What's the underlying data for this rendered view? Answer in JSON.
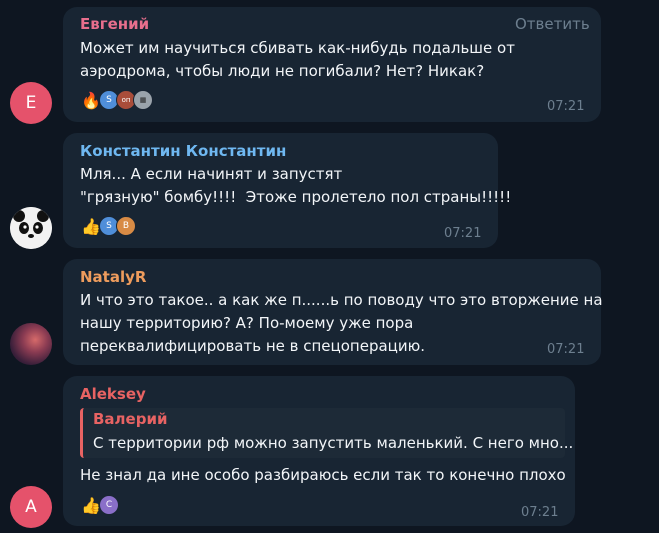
{
  "messages": [
    {
      "author": "Евгений",
      "author_color": "#e86f8d",
      "avatar_letter": "Е",
      "reply_label": "Ответить",
      "lines": [
        "Может им научиться сбивать как-нибудь подальше от",
        "аэродрома, чтобы люди не погибали? Нет? Никак?"
      ],
      "time": "07:21",
      "reactions": [
        "fire-icon",
        "S",
        "оп",
        "grid"
      ]
    },
    {
      "author": "Константин Константин",
      "author_color": "#6fb8f1",
      "avatar_icon": "panda-icon",
      "lines": [
        "Мля... А если начинят и запустят",
        "\"грязную\" бомбу!!!!  Этоже пролетело пол страны!!!!!"
      ],
      "time": "07:21",
      "reactions": [
        "thumbs-up-icon",
        "S",
        "B"
      ]
    },
    {
      "author": "NatalyR",
      "author_color": "#ee9c5d",
      "avatar_icon": "moon-icon",
      "lines": [
        "И что это такое.. а как же п......ь по поводу что это вторжение на",
        "нашу территорию? А? По-моему уже пора",
        "переквалифицировать не в спецоперацию."
      ],
      "time": "07:21"
    },
    {
      "author": "Aleksey",
      "author_color": "#e86363",
      "avatar_letter": "А",
      "quote": {
        "author": "Валерий",
        "text": "С территории рф можно запустить маленький. С него мно..."
      },
      "lines": [
        "Не знал да ине особо разбираюсь если так то конечно плохо"
      ],
      "time": "07:21",
      "reactions": [
        "thumbs-up-icon",
        "C"
      ]
    }
  ]
}
